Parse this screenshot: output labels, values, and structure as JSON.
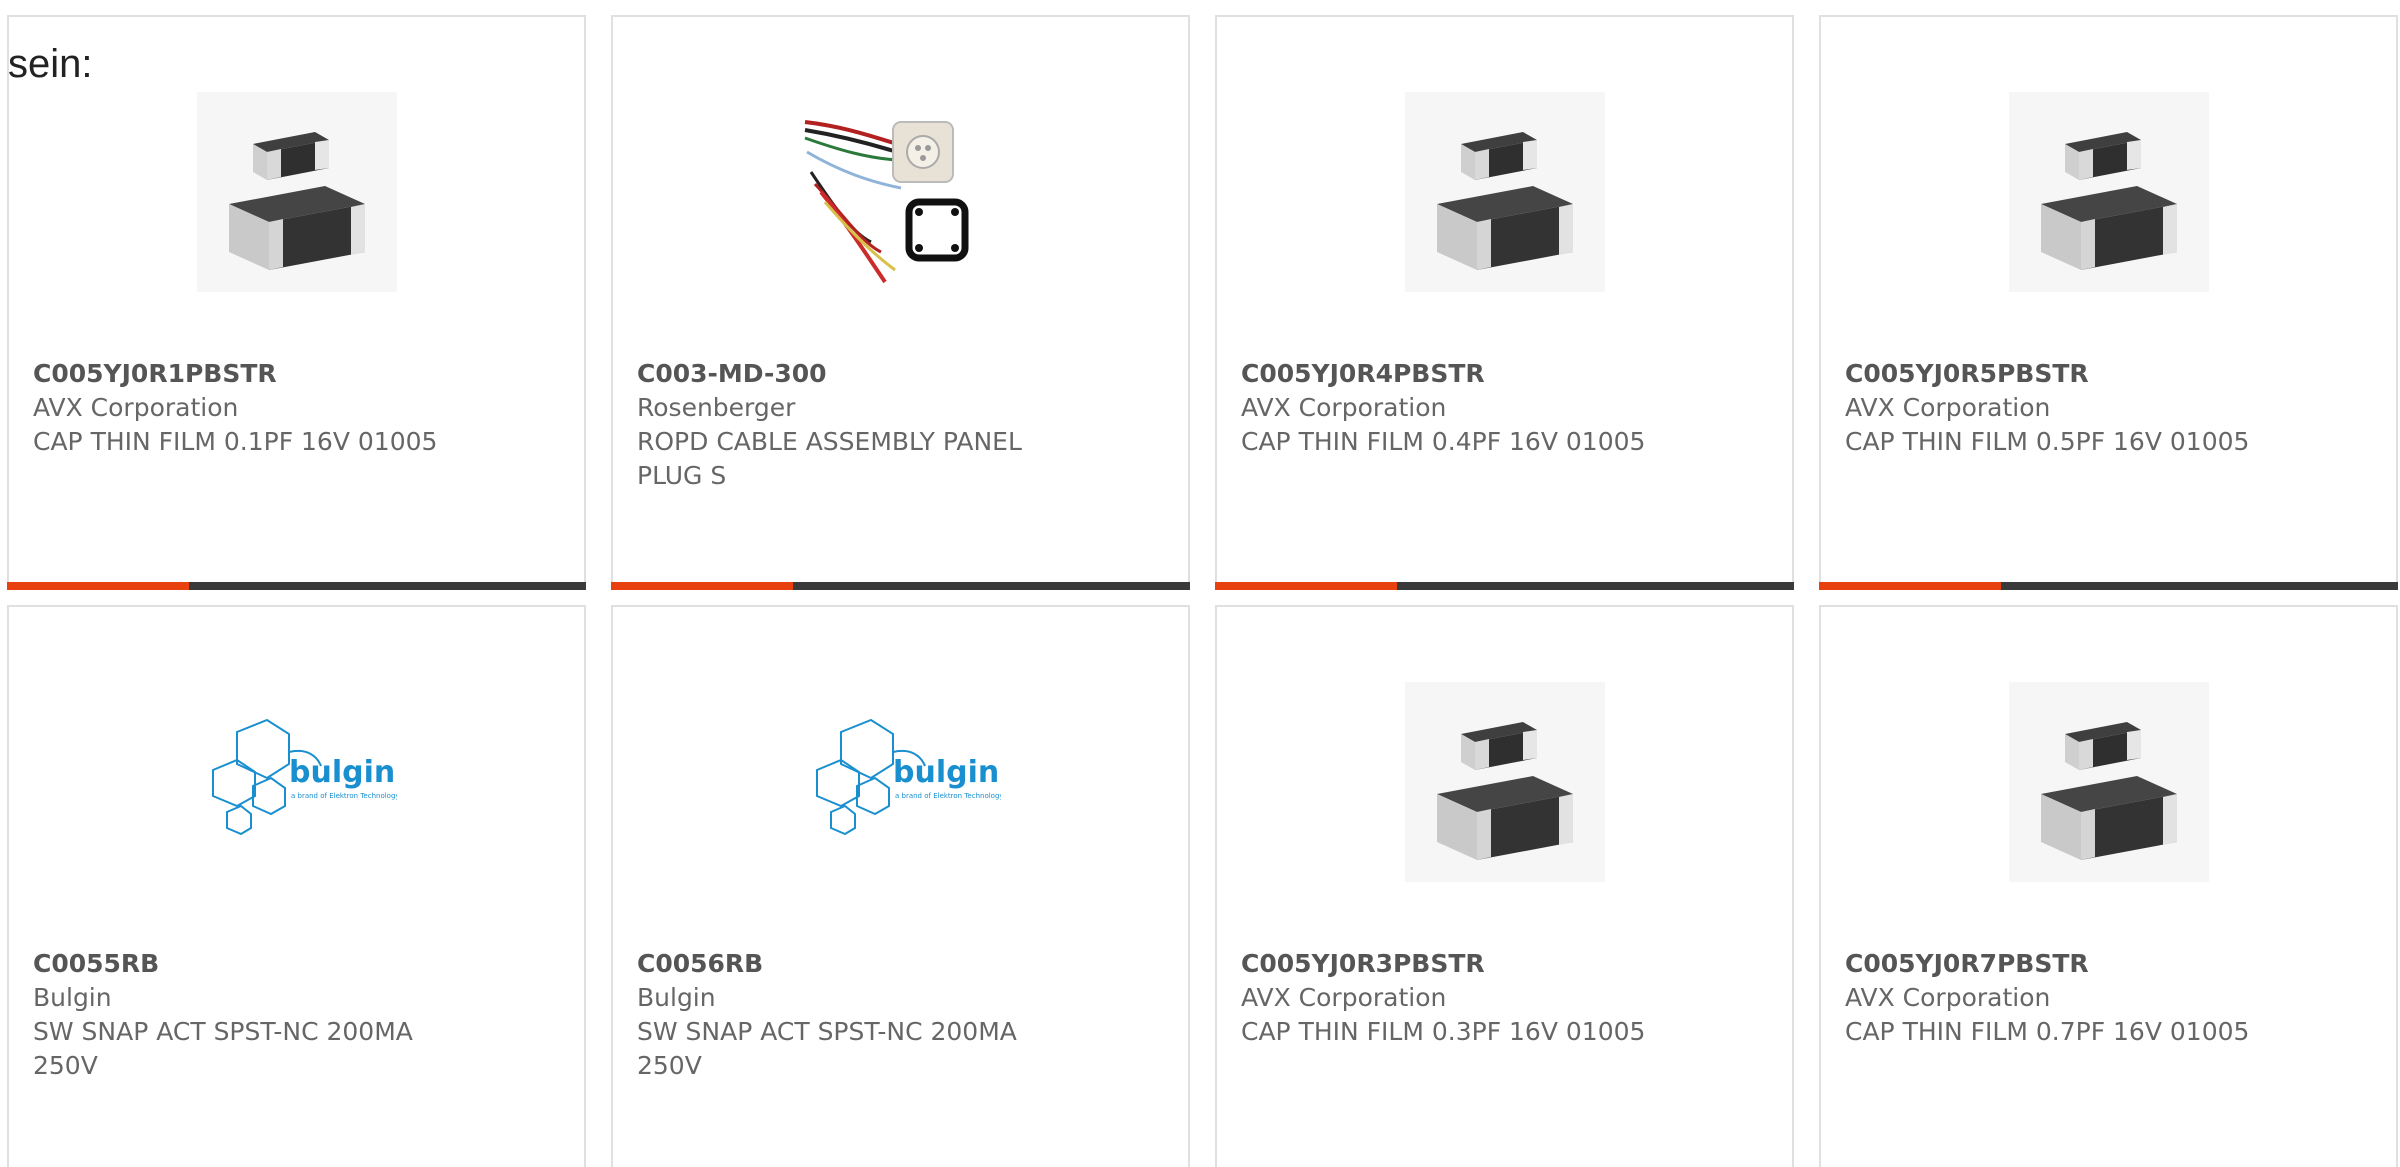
{
  "intro_text": "sein:",
  "accent_color": "#e8410f",
  "bar_color": "#3a3a3a",
  "products": [
    {
      "part_number": "C005YJ0R1PBSTR",
      "manufacturer": "AVX Corporation",
      "description": "CAP THIN FILM 0.1PF 16V 01005",
      "image": "smd-capacitor",
      "show_bar": true
    },
    {
      "part_number": "C003-MD-300",
      "manufacturer": "Rosenberger",
      "description": "ROPD CABLE ASSEMBLY PANEL PLUG S",
      "image": "cable-assembly",
      "show_bar": true
    },
    {
      "part_number": "C005YJ0R4PBSTR",
      "manufacturer": "AVX Corporation",
      "description": "CAP THIN FILM 0.4PF 16V 01005",
      "image": "smd-capacitor",
      "show_bar": true
    },
    {
      "part_number": "C005YJ0R5PBSTR",
      "manufacturer": "AVX Corporation",
      "description": "CAP THIN FILM 0.5PF 16V 01005",
      "image": "smd-capacitor",
      "show_bar": true
    },
    {
      "part_number": "C0055RB",
      "manufacturer": "Bulgin",
      "description": "SW SNAP ACT SPST-NC 200MA 250V",
      "image": "bulgin-logo",
      "show_bar": false
    },
    {
      "part_number": "C0056RB",
      "manufacturer": "Bulgin",
      "description": "SW SNAP ACT SPST-NC 200MA 250V",
      "image": "bulgin-logo",
      "show_bar": false
    },
    {
      "part_number": "C005YJ0R3PBSTR",
      "manufacturer": "AVX Corporation",
      "description": "CAP THIN FILM 0.3PF 16V 01005",
      "image": "smd-capacitor",
      "show_bar": false
    },
    {
      "part_number": "C005YJ0R7PBSTR",
      "manufacturer": "AVX Corporation",
      "description": "CAP THIN FILM 0.7PF 16V 01005",
      "image": "smd-capacitor",
      "show_bar": false
    }
  ],
  "bulgin_logo": {
    "brand": "bulgin",
    "tagline": "a brand of Elektron Technology",
    "color": "#1a8fd0"
  }
}
